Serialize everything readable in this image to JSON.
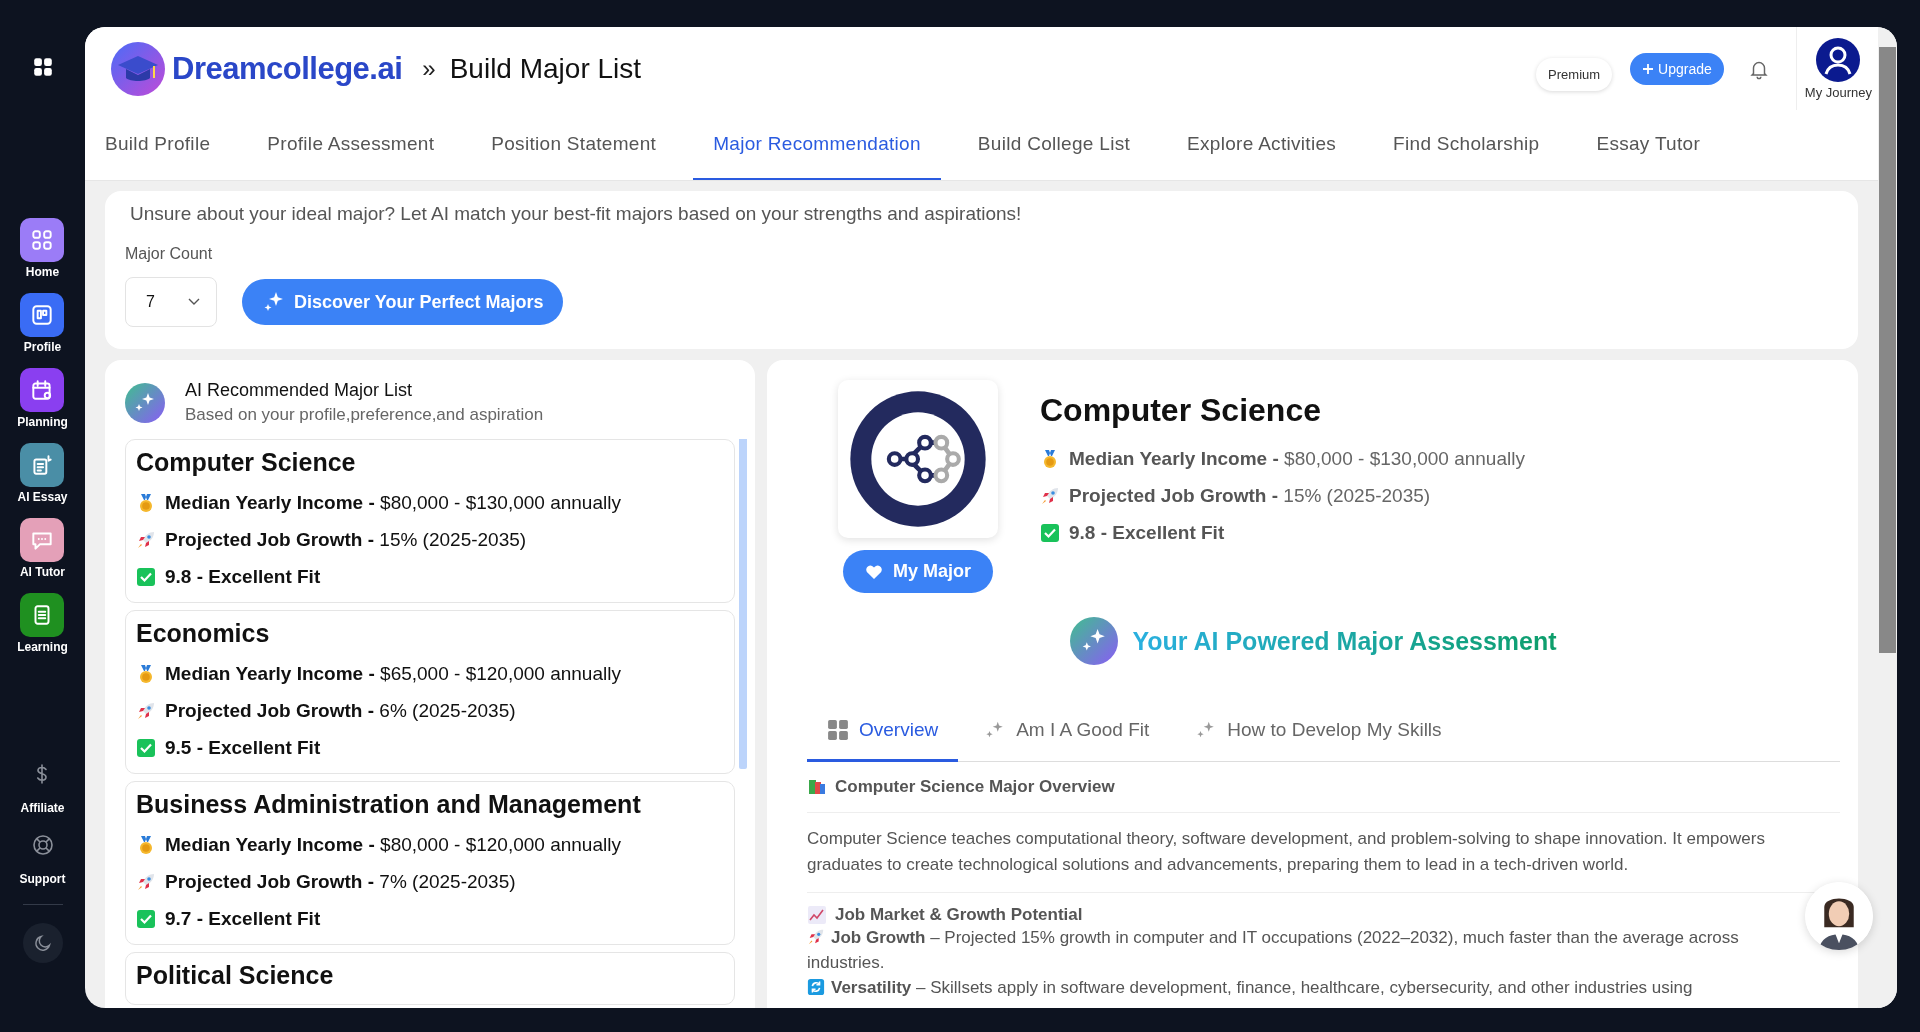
{
  "sidebar": {
    "items": [
      {
        "label": "Home",
        "color": "#9b7cf7"
      },
      {
        "label": "Profile",
        "color": "#3a6cf5"
      },
      {
        "label": "Planning",
        "color": "#8a3ff0"
      },
      {
        "label": "AI Essay",
        "color": "#4a8ea6"
      },
      {
        "label": "AI Tutor",
        "color": "#e4a0b8"
      },
      {
        "label": "Learning",
        "color": "#1f9020"
      }
    ],
    "footer_items": [
      {
        "label": "Affiliate"
      },
      {
        "label": "Support"
      }
    ]
  },
  "header": {
    "brand": "Dreamcollege.ai",
    "separator": "»",
    "title": "Build Major List",
    "premium": "Premium",
    "upgrade": "Upgrade",
    "profile_label": "My Journey"
  },
  "tabs": [
    {
      "label": "Build Profile",
      "selected": false
    },
    {
      "label": "Profile Assessment",
      "selected": false
    },
    {
      "label": "Position Statement",
      "selected": false
    },
    {
      "label": "Major Recommendation",
      "selected": true
    },
    {
      "label": "Build College List",
      "selected": false
    },
    {
      "label": "Explore Activities",
      "selected": false
    },
    {
      "label": "Find Scholarship",
      "selected": false
    },
    {
      "label": "Essay Tutor",
      "selected": false
    }
  ],
  "intro": {
    "text": "Unsure about your ideal major? Let AI match your best-fit majors based on your strengths and aspirations!",
    "count_label": "Major Count",
    "count_value": "7",
    "discover_button": "Discover Your Perfect Majors"
  },
  "major_list": {
    "title": "AI Recommended Major List",
    "subtitle": "Based on your profile,preference,and aspiration",
    "items": [
      {
        "name": "Computer Science",
        "income": "**Median Yearly Income -** $80,000 - $130,000 annually",
        "growth": "**Projected Job Growth -** 15% (2025-2035)",
        "fit": "9.8 - Excellent Fit"
      },
      {
        "name": "Economics",
        "income": "**Median Yearly Income -** $65,000 - $120,000 annually",
        "growth": "**Projected Job Growth -** 6% (2025-2035)",
        "fit": "9.5 - Excellent Fit"
      },
      {
        "name": "Business Administration and Management",
        "income": "**Median Yearly Income -** $80,000 - $120,000 annually",
        "growth": "**Projected Job Growth -** 7% (2025-2035)",
        "fit": "9.7 - Excellent Fit"
      },
      {
        "name": "Political Science"
      }
    ]
  },
  "detail": {
    "name": "Computer Science",
    "income": "**Median Yearly Income -** $80,000 - $130,000 annually",
    "growth": "**Projected Job Growth -** 15% (2025-2035)",
    "fit": "9.8 - Excellent Fit",
    "my_major_button": "My Major",
    "assessment_title": "Your AI Powered Major Assessment",
    "tabs": [
      {
        "label": "Overview",
        "selected": true
      },
      {
        "label": "Am I A Good Fit",
        "selected": false
      },
      {
        "label": "How to Develop My Skills",
        "selected": false
      }
    ],
    "section_title": "Computer Science Major Overview",
    "paragraph": "Computer Science teaches computational theory, software development, and problem-solving to shape innovation. It empowers graduates to create technological solutions and advancements, preparing them to lead in a tech-driven world.",
    "market_title": "Job Market & Growth Potential",
    "points": [
      {
        "kind": "rocket",
        "text": "**Job Growth** – Projected 15% growth in computer and IT occupations (2022–2032), much faster than the average across industries."
      },
      {
        "kind": "cycle",
        "text": "**Versatility** – Skillsets apply in software development, finance, healthcare, cybersecurity, and other industries using"
      }
    ]
  }
}
